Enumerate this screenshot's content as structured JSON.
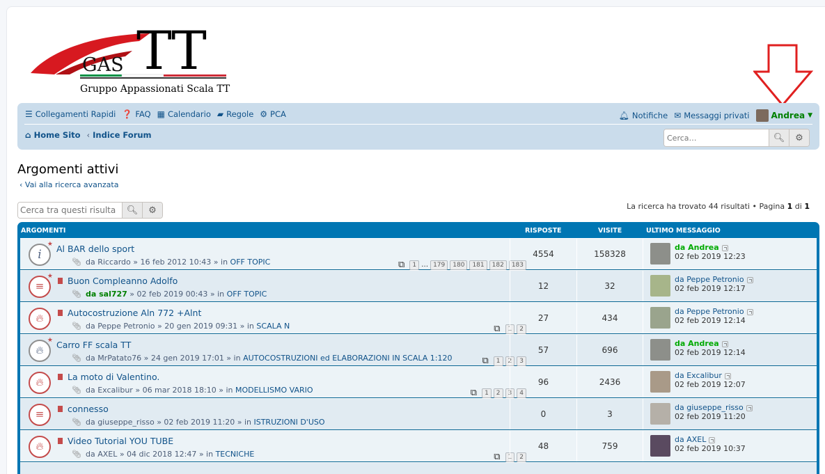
{
  "logo": {
    "gas": "GAS",
    "tt": "TT",
    "subtitle": "Gruppo Appassionati Scala TT"
  },
  "nav": {
    "quick_links": "Collegamenti Rapidi",
    "faq": "FAQ",
    "calendar": "Calendario",
    "rules": "Regole",
    "ucp": "PCA",
    "notifications": "Notifiche",
    "private_messages": "Messaggi privati",
    "username": "Andrea",
    "crumb_home": "Home Sito",
    "crumb_index": "Indice Forum",
    "search_placeholder": "Cerca…"
  },
  "page": {
    "title": "Argomenti attivi",
    "advanced_link": "Vai alla ricerca avanzata",
    "search_results_placeholder": "Cerca tra questi risulta",
    "found_prefix": "La ricerca ha trovato 44 risultati • Pagina ",
    "page_num": "1",
    "of": " di ",
    "page_total": "1"
  },
  "table": {
    "headers": {
      "topics": "ARGOMENTI",
      "replies": "RISPOSTE",
      "views": "VISITE",
      "last": "ULTIMO MESSAGGIO"
    },
    "rows": [
      {
        "title": "Al BAR dello sport",
        "meta_author": "da Riccardo",
        "meta_rest": " » 16 feb 2012 10:43 » in ",
        "forum": "OFF TOPIC",
        "pages": [
          "1",
          "…",
          "179",
          "180",
          "181",
          "182",
          "183"
        ],
        "replies": "4554",
        "views": "158328",
        "last_user": "da Andrea",
        "last_date": "02 feb 2019 12:23"
      },
      {
        "title": "Buon Compleanno Adolfo",
        "meta_author": "da sal727",
        "meta_rest": " » 02 feb 2019 00:43 » in ",
        "forum": "OFF TOPIC",
        "pages": [],
        "replies": "12",
        "views": "32",
        "last_user": "da Peppe Petronio",
        "last_date": "02 feb 2019 12:17"
      },
      {
        "title": "Autocostruzione Aln 772 +Alnt",
        "meta_author": "da Peppe Petronio",
        "meta_rest": " » 20 gen 2019 09:31 » in ",
        "forum": "SCALA N",
        "pages": [
          "1",
          "2"
        ],
        "replies": "27",
        "views": "434",
        "last_user": "da Peppe Petronio",
        "last_date": "02 feb 2019 12:14"
      },
      {
        "title": "Carro FF scala TT",
        "meta_author": "da MrPatato76",
        "meta_rest": " » 24 gen 2019 17:01 » in ",
        "forum": "AUTOCOSTRUZIONI ed ELABORAZIONI IN SCALA 1:120",
        "pages": [
          "1",
          "2",
          "3"
        ],
        "replies": "57",
        "views": "696",
        "last_user": "da Andrea",
        "last_date": "02 feb 2019 12:14"
      },
      {
        "title": "La moto di Valentino.",
        "meta_author": "da Excalibur",
        "meta_rest": " » 06 mar 2018 18:10 » in ",
        "forum": "MODELLISMO VARIO",
        "pages": [
          "1",
          "2",
          "3",
          "4"
        ],
        "replies": "96",
        "views": "2436",
        "last_user": "da Excalibur",
        "last_date": "02 feb 2019 12:07"
      },
      {
        "title": "connesso",
        "meta_author": "da giuseppe_risso",
        "meta_rest": " » 02 feb 2019 11:20 » in ",
        "forum": "ISTRUZIONI D'USO",
        "pages": [],
        "replies": "0",
        "views": "3",
        "last_user": "da giuseppe_risso",
        "last_date": "02 feb 2019 11:20"
      },
      {
        "title": "Video Tutorial YOU TUBE",
        "meta_author": "da AXEL",
        "meta_rest": " » 04 dic 2018 12:47 » in ",
        "forum": "TECNICHE",
        "pages": [
          "1",
          "2"
        ],
        "replies": "48",
        "views": "759",
        "last_user": "da AXEL",
        "last_date": "02 feb 2019 10:37"
      }
    ]
  },
  "colors": {
    "nav_bg": "#cadceb",
    "table_header": "#0076b3",
    "link": "#105289",
    "user_green": "#00aa00",
    "arrow_red": "#e02020"
  }
}
